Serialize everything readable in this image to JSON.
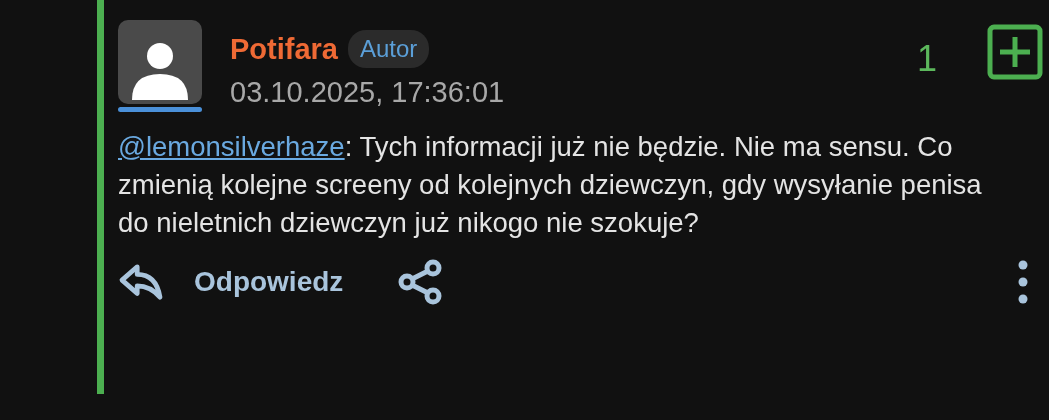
{
  "comment": {
    "author": "Potifara",
    "badge": "Autor",
    "date": "03.10.2025, 17:36:01",
    "score": "1",
    "mention": "@lemonsilverhaze",
    "text": ": Tych informacji już nie będzie. Nie ma sensu. Co zmienią kolejne screeny od kolejnych dziewczyn, gdy wysyłanie penisa do nieletnich dziewczyn już nikogo nie szokuje?",
    "reply_label": "Odpowiedz"
  }
}
